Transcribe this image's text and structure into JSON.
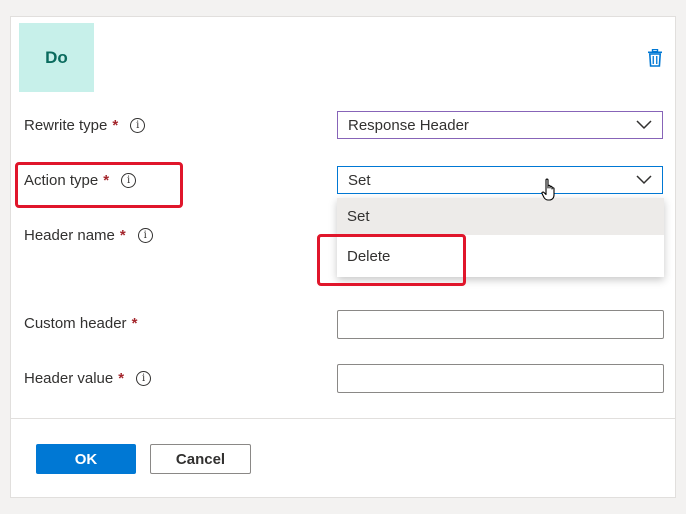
{
  "tile": {
    "label": "Do"
  },
  "icons": {
    "delete": "trash-icon",
    "info": "info-icon",
    "chevron": "chevron-down-icon",
    "cursor": "hand-pointer-cursor"
  },
  "fields": {
    "rewrite_type": {
      "label": "Rewrite type",
      "required": "*",
      "value": "Response Header"
    },
    "action_type": {
      "label": "Action type",
      "required": "*",
      "value": "Set"
    },
    "header_name": {
      "label": "Header name",
      "required": "*"
    },
    "custom_header": {
      "label": "Custom header",
      "required": "*",
      "value": ""
    },
    "header_value": {
      "label": "Header value",
      "required": "*",
      "value": ""
    }
  },
  "action_menu": {
    "options": [
      "Set",
      "Delete"
    ],
    "selected": "Set"
  },
  "info_glyph": "i",
  "buttons": {
    "ok": "OK",
    "cancel": "Cancel"
  },
  "colors": {
    "accent": "#0078d4",
    "highlight": "#e0162b",
    "tile": "#c7f0ea",
    "required": "#a4262c"
  }
}
